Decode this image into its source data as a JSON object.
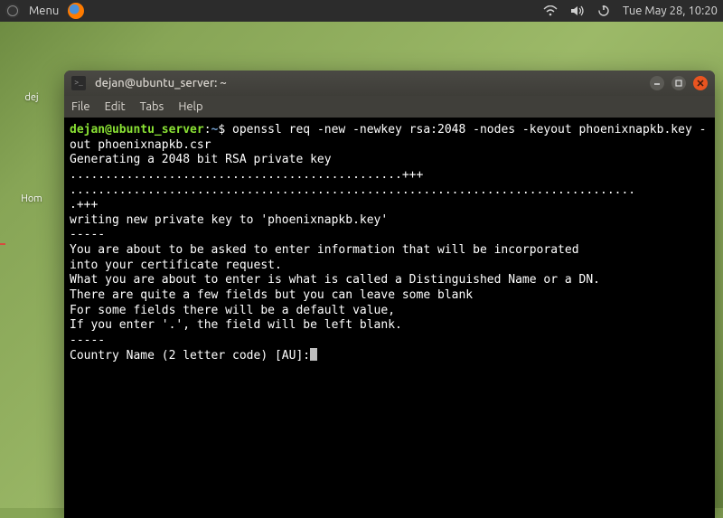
{
  "topbar": {
    "menu_label": "Menu",
    "clock": "Tue May 28, 10:20"
  },
  "desktop": {
    "icon1_label": "dej",
    "icon2_label": "Hom"
  },
  "window": {
    "title": "dejan@ubuntu_server: ~",
    "menu": {
      "file": "File",
      "edit": "Edit",
      "tabs": "Tabs",
      "help": "Help"
    }
  },
  "terminal": {
    "prompt_userhost": "dejan@ubuntu_server",
    "prompt_sep": ":",
    "prompt_path": "~",
    "prompt_dollar": "$ ",
    "command": "openssl req -new -newkey rsa:2048 -nodes -keyout phoenixnapkb.key -out phoenixnapkb.csr",
    "lines": [
      "Generating a 2048 bit RSA private key",
      "...............................................+++",
      "................................................................................",
      ".+++",
      "writing new private key to 'phoenixnapkb.key'",
      "-----",
      "You are about to be asked to enter information that will be incorporated",
      "into your certificate request.",
      "What you are about to enter is what is called a Distinguished Name or a DN.",
      "There are quite a few fields but you can leave some blank",
      "For some fields there will be a default value,",
      "If you enter '.', the field will be left blank.",
      "-----",
      "Country Name (2 letter code) [AU]:"
    ]
  }
}
